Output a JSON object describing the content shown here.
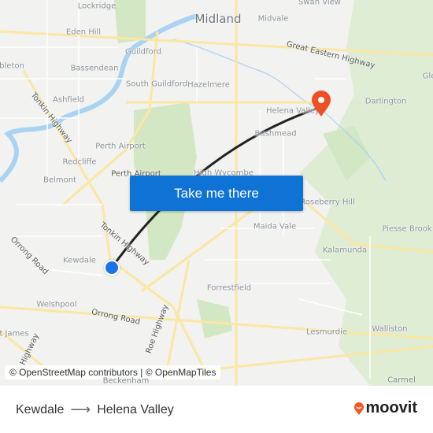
{
  "map": {
    "labels": {
      "lockridge": "Lockridge",
      "eden_hill": "Eden Hill",
      "midland": "Midland",
      "midvale": "Midvale",
      "swan_view": "Swan View",
      "guildford": "Guildford",
      "great_eastern_highway": "Great Eastern Highway",
      "bleton": "bleton",
      "bassendean": "Bassendean",
      "south_guildford": "South Guildford",
      "hazelmere": "Hazelmere",
      "ashfield": "Ashfield",
      "tonkin_highway_north": "Tonkin Highway",
      "gle": "Gle",
      "darlington": "Darlington",
      "helena_valley": "Helena Valley",
      "bushmead": "Bushmead",
      "perth_airport_suburb": "Perth Airport",
      "redcliffe": "Redcliffe",
      "perth_airport": "Perth Airport",
      "high_wycombe": "High Wycombe",
      "belmont": "Belmont",
      "roseberry_hill": "Roseberry Hill",
      "maida_vale": "Maida Vale",
      "piesse_brook": "Piesse Brook",
      "tonkin_highway_south": "Tonkin Highway",
      "orrong_road_west": "Orrong Road",
      "kewdale": "Kewdale",
      "kalamunda": "Kalamunda",
      "forrestfield": "Forrestfield",
      "welshpool": "Welshpool",
      "orrong_road": "Orrong Road",
      "roe_highway": "Roe Highway",
      "walliston": "Walliston",
      "lesmurdie": "Lesmurdie",
      "st_james": "t James",
      "south_highway": "th Highway",
      "carmel": "Carmel",
      "beckenham": "Beckenham"
    },
    "origin_marker_color": "#1a73e8",
    "destination_marker_color": "#f04e23",
    "route_color": "#222222",
    "attribution": "© OpenStreetMap contributors | © OpenMapTiles"
  },
  "cta": {
    "label": "Take me there",
    "color": "#0f73d6"
  },
  "footer": {
    "origin": "Kewdale",
    "arrow_icon": "arrow-right-icon",
    "destination": "Helena Valley",
    "brand": "moovit",
    "brand_color": "#f05a22"
  }
}
